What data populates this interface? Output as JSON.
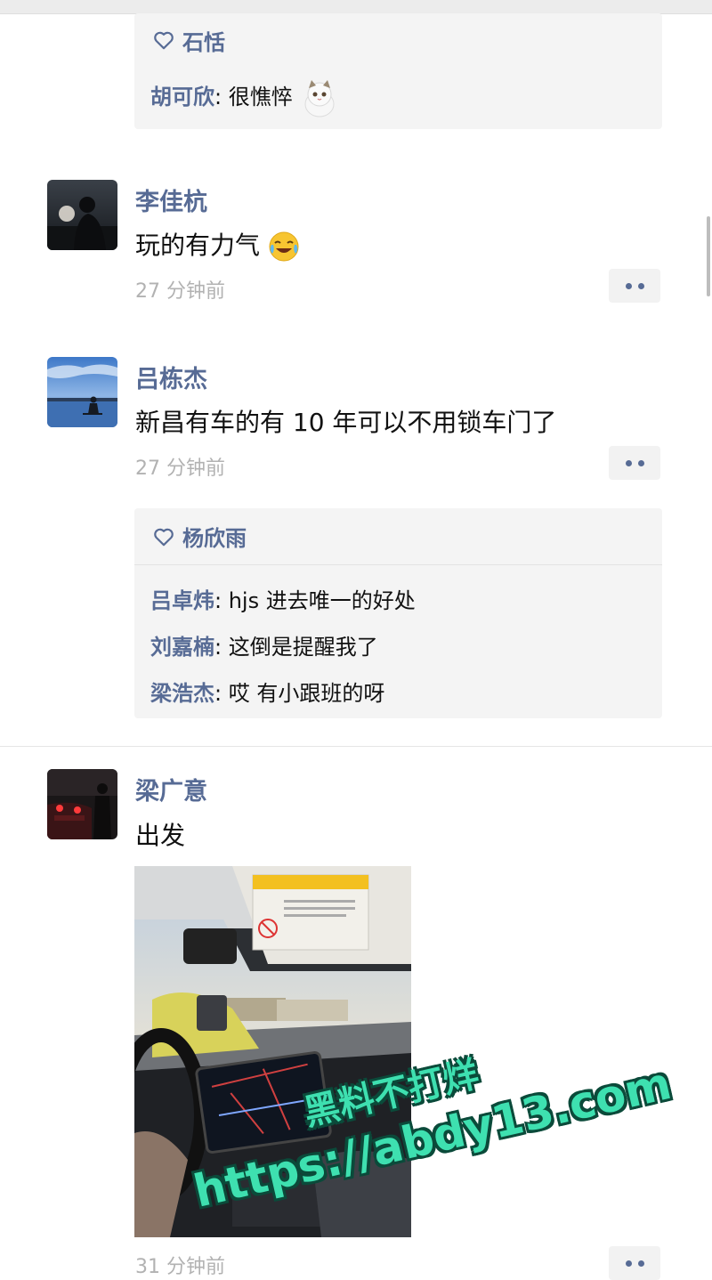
{
  "top_block": {
    "likers": "石恬",
    "comments": [
      {
        "author": "胡可欣",
        "text": "很憔悴",
        "emoji": "cat-sticker"
      }
    ]
  },
  "posts": [
    {
      "author": "李佳杭",
      "text": "玩的有力气",
      "emoji": "crying-laughing-face",
      "time": "27 分钟前",
      "avatar": "person-silhouette-sunset"
    },
    {
      "author": "吕栋杰",
      "text": "新昌有车的有 10 年可以不用锁车门了",
      "time": "27 分钟前",
      "avatar": "lakeside-blue-sky",
      "likes": "杨欣雨",
      "comments": [
        {
          "author": "吕卓炜",
          "text": "hjs 进去唯一的好处"
        },
        {
          "author": "刘嘉楠",
          "text": "这倒是提醒我了"
        },
        {
          "author": "梁浩杰",
          "text": "哎 有小跟班的呀"
        }
      ]
    },
    {
      "author": "梁广意",
      "text": "出发",
      "time": "31 分钟前",
      "avatar": "night-car-taillights",
      "photo": "car-interior-driving"
    }
  ],
  "watermark": {
    "line1": "黑料不打烊",
    "line2": "https://abdy13.com"
  },
  "colors": {
    "name_blue": "#576b95",
    "time_gray": "#b2b2b2",
    "block_bg": "#f4f4f4",
    "watermark_green": "#3ee0b0"
  }
}
